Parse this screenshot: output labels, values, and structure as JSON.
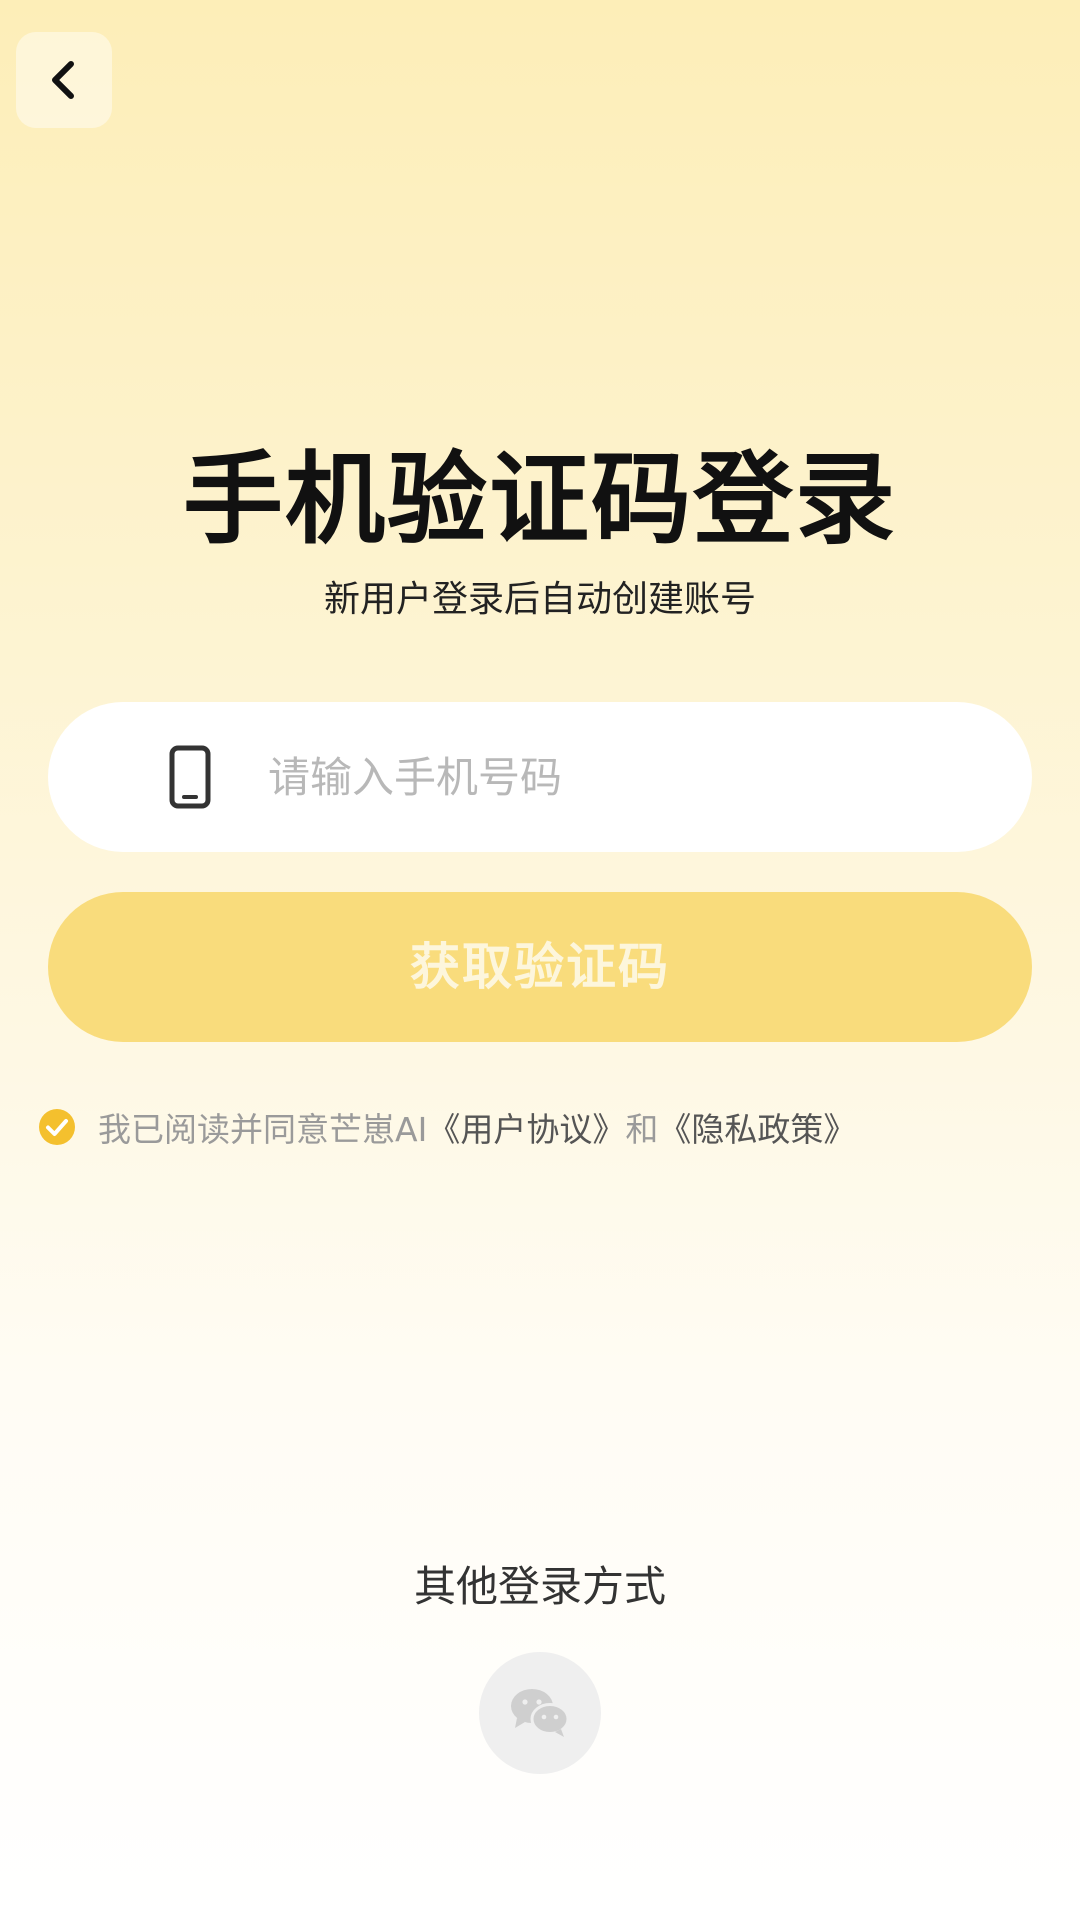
{
  "header": {
    "back_icon": "chevron-left-icon"
  },
  "login": {
    "title": "手机验证码登录",
    "subtitle": "新用户登录后自动创建账号",
    "phone_placeholder": "请输入手机号码",
    "phone_value": "",
    "phone_icon": "smartphone-icon",
    "get_code_label": "获取验证码"
  },
  "agreement": {
    "checked": true,
    "prefix": "我已阅读并同意芒崽AI",
    "user_agreement": "《用户协议》",
    "conjunction": "和",
    "privacy_policy": "《隐私政策》"
  },
  "other_login": {
    "title": "其他登录方式",
    "wechat_icon": "wechat-icon"
  },
  "colors": {
    "accent": "#f4c02e",
    "button_disabled": "#f9dc7c",
    "title_text": "#111111"
  }
}
